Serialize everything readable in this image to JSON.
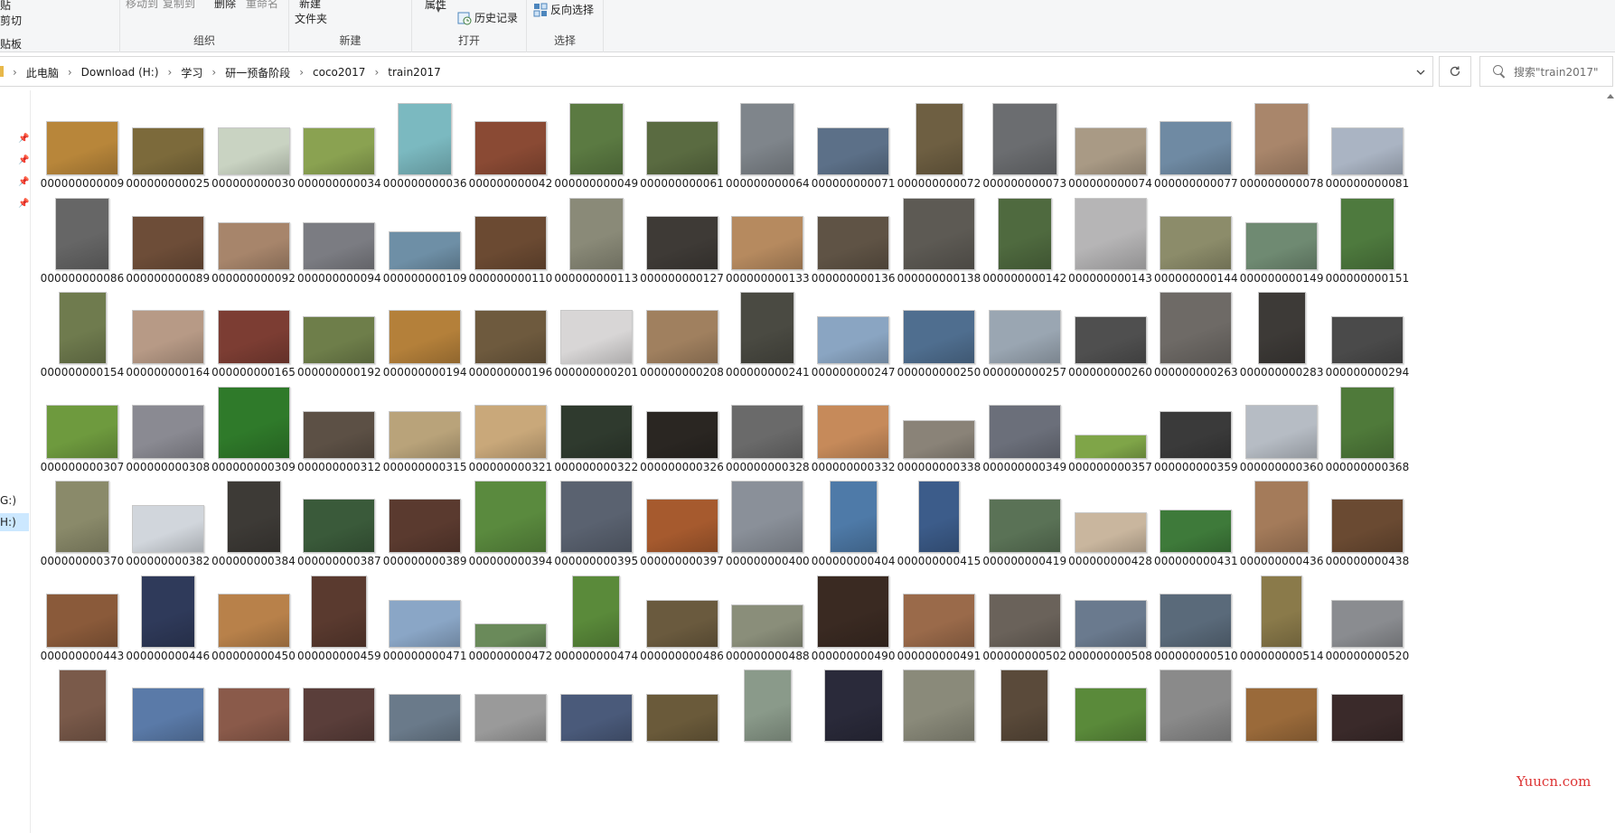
{
  "ribbon": {
    "clipboard": {
      "paste_partial": "贴",
      "cut": "剪切",
      "label_partial": "贴板"
    },
    "organize": {
      "move_to": "移动到",
      "copy_to": "复制到",
      "delete": "删除",
      "rename": "重命名",
      "label": "组织"
    },
    "new": {
      "new_top": "新建",
      "new_folder": "文件夹",
      "label": "新建"
    },
    "open": {
      "properties": "属性",
      "history": "历史记录",
      "label": "打开"
    },
    "select": {
      "invert": "反向选择",
      "label": "选择"
    }
  },
  "address": {
    "crumbs": [
      "此电脑",
      "Download (H:)",
      "学习",
      "研一预备阶段",
      "coco2017",
      "train2017"
    ],
    "search_placeholder": "搜索\"train2017\""
  },
  "nav": {
    "drive_g": "G:)",
    "drive_h": "H:)"
  },
  "watermark": "Yuucn.com",
  "files": [
    {
      "name": "000000000009",
      "color": "#b8863a",
      "ar": 1.33
    },
    {
      "name": "000000000025",
      "color": "#7c6a3b",
      "ar": 1.5
    },
    {
      "name": "000000000030",
      "color": "#c9d3c2",
      "ar": 1.5
    },
    {
      "name": "000000000034",
      "color": "#8aa251",
      "ar": 1.5
    },
    {
      "name": "000000000036",
      "color": "#7bb9c0",
      "ar": 0.75
    },
    {
      "name": "000000000042",
      "color": "#8a4a34",
      "ar": 1.33
    },
    {
      "name": "000000000049",
      "color": "#5b7a42",
      "ar": 0.75
    },
    {
      "name": "000000000061",
      "color": "#5a6b41",
      "ar": 1.33
    },
    {
      "name": "000000000064",
      "color": "#7f858b",
      "ar": 0.75
    },
    {
      "name": "000000000071",
      "color": "#5c7088",
      "ar": 1.5
    },
    {
      "name": "000000000072",
      "color": "#6e5f42",
      "ar": 0.66
    },
    {
      "name": "000000000073",
      "color": "#6b6d70",
      "ar": 0.9
    },
    {
      "name": "000000000074",
      "color": "#a99a85",
      "ar": 1.5
    },
    {
      "name": "000000000077",
      "color": "#6f8aa3",
      "ar": 1.33
    },
    {
      "name": "000000000078",
      "color": "#a9866b",
      "ar": 0.75
    },
    {
      "name": "000000000081",
      "color": "#aab4c3",
      "ar": 1.5
    },
    {
      "name": "000000000086",
      "color": "#666666",
      "ar": 0.75
    },
    {
      "name": "000000000089",
      "color": "#6d4d38",
      "ar": 1.33
    },
    {
      "name": "000000000092",
      "color": "#a7856b",
      "ar": 1.5
    },
    {
      "name": "000000000094",
      "color": "#7b7c82",
      "ar": 1.5
    },
    {
      "name": "000000000109",
      "color": "#6e8fa6",
      "ar": 1.85
    },
    {
      "name": "000000000110",
      "color": "#6b4a32",
      "ar": 1.33
    },
    {
      "name": "000000000113",
      "color": "#8a8a78",
      "ar": 0.75
    },
    {
      "name": "000000000127",
      "color": "#3e3a36",
      "ar": 1.33
    },
    {
      "name": "000000000133",
      "color": "#b68a5f",
      "ar": 1.33
    },
    {
      "name": "000000000136",
      "color": "#5f5345",
      "ar": 1.33
    },
    {
      "name": "000000000138",
      "color": "#5d5a54",
      "ar": 1.0
    },
    {
      "name": "000000000142",
      "color": "#4f6a3f",
      "ar": 0.75
    },
    {
      "name": "000000000143",
      "color": "#b6b5b6",
      "ar": 1.0
    },
    {
      "name": "000000000144",
      "color": "#8c8c6a",
      "ar": 1.33
    },
    {
      "name": "000000000149",
      "color": "#6f8a72",
      "ar": 1.5
    },
    {
      "name": "000000000151",
      "color": "#4e7a3e",
      "ar": 0.75
    },
    {
      "name": "000000000154",
      "color": "#6f7b4e",
      "ar": 0.66
    },
    {
      "name": "000000000164",
      "color": "#b79a86",
      "ar": 1.33
    },
    {
      "name": "000000000165",
      "color": "#7c3d33",
      "ar": 1.33
    },
    {
      "name": "000000000192",
      "color": "#6e7e4a",
      "ar": 1.5
    },
    {
      "name": "000000000194",
      "color": "#b4803a",
      "ar": 1.33
    },
    {
      "name": "000000000196",
      "color": "#6e5a3e",
      "ar": 1.33
    },
    {
      "name": "000000000201",
      "color": "#d8d6d6",
      "ar": 1.33
    },
    {
      "name": "000000000208",
      "color": "#a0805f",
      "ar": 1.33
    },
    {
      "name": "000000000241",
      "color": "#4a4a42",
      "ar": 0.75
    },
    {
      "name": "000000000247",
      "color": "#8aa5c2",
      "ar": 1.5
    },
    {
      "name": "000000000250",
      "color": "#4f6e8f",
      "ar": 1.33
    },
    {
      "name": "000000000257",
      "color": "#9aa6b2",
      "ar": 1.33
    },
    {
      "name": "000000000260",
      "color": "#4f4f4f",
      "ar": 1.5
    },
    {
      "name": "000000000263",
      "color": "#6e6a66",
      "ar": 1.0
    },
    {
      "name": "000000000283",
      "color": "#3d3a37",
      "ar": 0.66
    },
    {
      "name": "000000000294",
      "color": "#4a4a4a",
      "ar": 1.5
    },
    {
      "name": "000000000307",
      "color": "#6e9a3e",
      "ar": 1.33
    },
    {
      "name": "000000000308",
      "color": "#8a8a92",
      "ar": 1.33
    },
    {
      "name": "000000000309",
      "color": "#2f7a2a",
      "ar": 1.0
    },
    {
      "name": "000000000312",
      "color": "#5c5045",
      "ar": 1.5
    },
    {
      "name": "000000000315",
      "color": "#b9a37a",
      "ar": 1.5
    },
    {
      "name": "000000000321",
      "color": "#c9a87a",
      "ar": 1.33
    },
    {
      "name": "000000000322",
      "color": "#2f3a2e",
      "ar": 1.33
    },
    {
      "name": "000000000326",
      "color": "#2a2622",
      "ar": 1.5
    },
    {
      "name": "000000000328",
      "color": "#6a6a6a",
      "ar": 1.33
    },
    {
      "name": "000000000332",
      "color": "#c68a5a",
      "ar": 1.33
    },
    {
      "name": "000000000338",
      "color": "#8a8378",
      "ar": 1.85
    },
    {
      "name": "000000000349",
      "color": "#6b6f7a",
      "ar": 1.33
    },
    {
      "name": "000000000357",
      "color": "#7fa548",
      "ar": 3.0
    },
    {
      "name": "000000000359",
      "color": "#3a3a3a",
      "ar": 1.5
    },
    {
      "name": "000000000360",
      "color": "#b6bcc4",
      "ar": 1.33
    },
    {
      "name": "000000000368",
      "color": "#4f7a3a",
      "ar": 0.75
    },
    {
      "name": "000000000370",
      "color": "#8a8a6a",
      "ar": 0.75
    },
    {
      "name": "000000000382",
      "color": "#d1d6dc",
      "ar": 1.5
    },
    {
      "name": "000000000384",
      "color": "#3d3a36",
      "ar": 0.75
    },
    {
      "name": "000000000387",
      "color": "#3a5a3a",
      "ar": 1.33
    },
    {
      "name": "000000000389",
      "color": "#5a3a2f",
      "ar": 1.33
    },
    {
      "name": "000000000394",
      "color": "#5a8a3e",
      "ar": 1.0
    },
    {
      "name": "000000000395",
      "color": "#5a6270",
      "ar": 1.0
    },
    {
      "name": "000000000397",
      "color": "#a65a2e",
      "ar": 1.33
    },
    {
      "name": "000000000400",
      "color": "#8a9099",
      "ar": 1.0
    },
    {
      "name": "000000000404",
      "color": "#4e7aa8",
      "ar": 0.66
    },
    {
      "name": "000000000415",
      "color": "#3c5c8a",
      "ar": 0.58
    },
    {
      "name": "000000000419",
      "color": "#5a7256",
      "ar": 1.33
    },
    {
      "name": "000000000428",
      "color": "#c9b69e",
      "ar": 1.78
    },
    {
      "name": "000000000431",
      "color": "#3e7a3a",
      "ar": 1.66
    },
    {
      "name": "000000000436",
      "color": "#a47b5a",
      "ar": 0.75
    },
    {
      "name": "000000000438",
      "color": "#6a4a32",
      "ar": 1.33
    },
    {
      "name": "000000000443",
      "color": "#8a5a3a",
      "ar": 1.33
    },
    {
      "name": "000000000446",
      "color": "#2f3a5a",
      "ar": 0.75
    },
    {
      "name": "000000000450",
      "color": "#b8814a",
      "ar": 1.33
    },
    {
      "name": "000000000459",
      "color": "#5a3a2f",
      "ar": 0.78
    },
    {
      "name": "000000000471",
      "color": "#8aa6c6",
      "ar": 1.5
    },
    {
      "name": "000000000472",
      "color": "#6a8a5a",
      "ar": 3.0
    },
    {
      "name": "000000000474",
      "color": "#5a8a3a",
      "ar": 0.66
    },
    {
      "name": "000000000486",
      "color": "#6a5a3e",
      "ar": 1.5
    },
    {
      "name": "000000000488",
      "color": "#8a8e7a",
      "ar": 1.66
    },
    {
      "name": "000000000490",
      "color": "#3a2a22",
      "ar": 1.0
    },
    {
      "name": "000000000491",
      "color": "#9a6a4a",
      "ar": 1.33
    },
    {
      "name": "000000000502",
      "color": "#6a625a",
      "ar": 1.33
    },
    {
      "name": "000000000508",
      "color": "#6a7a8e",
      "ar": 1.5
    },
    {
      "name": "000000000510",
      "color": "#5a6a7a",
      "ar": 1.33
    },
    {
      "name": "000000000514",
      "color": "#8a7a4a",
      "ar": 0.58
    },
    {
      "name": "000000000520",
      "color": "#8a8c90",
      "ar": 1.5
    },
    {
      "name": "",
      "color": "#7a5a4a",
      "ar": 0.66
    },
    {
      "name": "",
      "color": "#5a7aa8",
      "ar": 1.33
    },
    {
      "name": "",
      "color": "#8a5a4a",
      "ar": 1.33
    },
    {
      "name": "",
      "color": "#5a3e3a",
      "ar": 1.33
    },
    {
      "name": "",
      "color": "#6a7a8a",
      "ar": 1.5
    },
    {
      "name": "",
      "color": "#9a9a9a",
      "ar": 1.5
    },
    {
      "name": "",
      "color": "#4a5a7a",
      "ar": 1.5
    },
    {
      "name": "",
      "color": "#6a5a3a",
      "ar": 1.5
    },
    {
      "name": "",
      "color": "#8a9a8a",
      "ar": 0.66
    },
    {
      "name": "",
      "color": "#2a2a3a",
      "ar": 0.81
    },
    {
      "name": "",
      "color": "#8a8a7a",
      "ar": 1.0
    },
    {
      "name": "",
      "color": "#5a4a3a",
      "ar": 0.66
    },
    {
      "name": "",
      "color": "#5a8a3a",
      "ar": 1.33
    },
    {
      "name": "",
      "color": "#8a8a8a",
      "ar": 1.0
    },
    {
      "name": "",
      "color": "#9a6a3a",
      "ar": 1.33
    },
    {
      "name": "",
      "color": "#3a2a2a",
      "ar": 1.5
    }
  ]
}
